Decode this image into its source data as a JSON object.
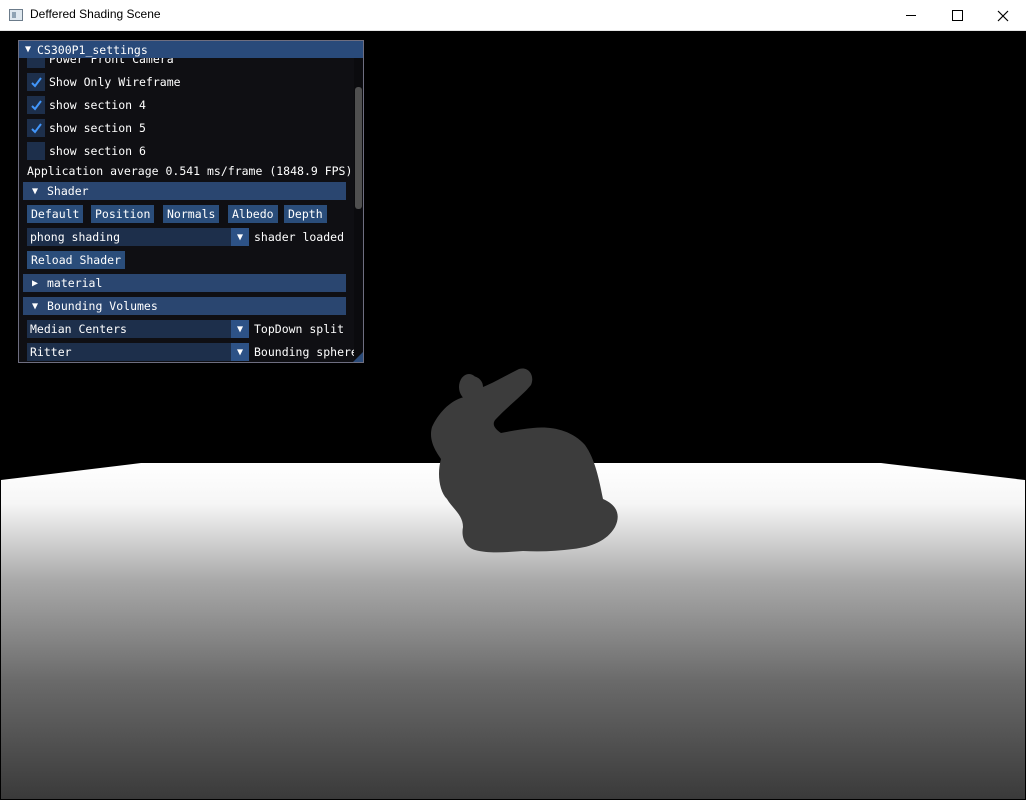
{
  "window": {
    "title": "Deffered Shading Scene"
  },
  "imgui": {
    "title": "CS300P1_settings",
    "partial_top_label": "Power Front Camera",
    "checkboxes": [
      {
        "label": "Show Only Wireframe",
        "checked": true
      },
      {
        "label": "show section 4",
        "checked": true
      },
      {
        "label": "show section 5",
        "checked": true
      },
      {
        "label": "show section 6",
        "checked": false
      }
    ],
    "fps_text": "Application average 0.541 ms/frame (1848.9 FPS)",
    "shader_header": "Shader",
    "shader_buttons": [
      "Default",
      "Position",
      "Normals",
      "Albedo",
      "Depth"
    ],
    "shader_combo": {
      "value": "phong shading",
      "status": "shader loaded"
    },
    "reload_button": "Reload Shader",
    "material_header": "material",
    "bv_header": "Bounding Volumes",
    "bv_combo1": {
      "value": "Median Centers",
      "side": "TopDown split"
    },
    "bv_combo2": {
      "value": "Ritter",
      "side": "Bounding sphere"
    }
  },
  "colors": {
    "title_bg": "#294a7a",
    "header_bg": "#2a4670",
    "checkbox_bg": "#1d2f4b",
    "accent": "#4296fa"
  }
}
